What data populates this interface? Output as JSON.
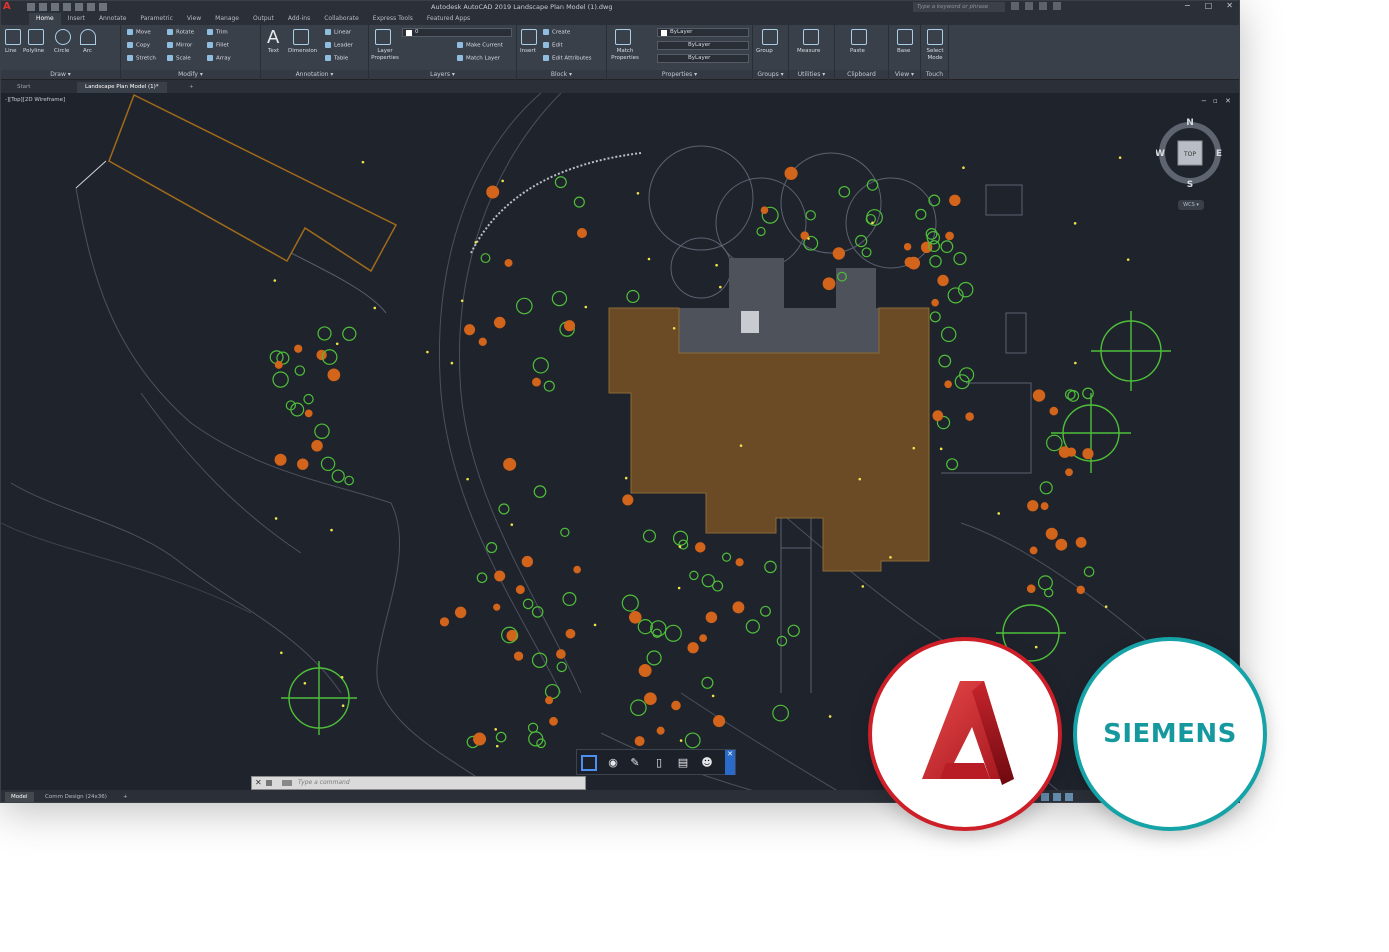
{
  "window": {
    "app_logo": "A",
    "title": "Autodesk AutoCAD 2019   Landscape Plan Model (1).dwg",
    "search_placeholder": "Type a keyword or phrase",
    "controls": [
      "−",
      "□",
      "✕"
    ]
  },
  "ribbon_tabs": [
    "Home",
    "Insert",
    "Annotate",
    "Parametric",
    "View",
    "Manage",
    "Output",
    "Add-ins",
    "Collaborate",
    "Express Tools",
    "Featured Apps"
  ],
  "ribbon": {
    "draw": {
      "title": "Draw ▾",
      "tools": [
        "Line",
        "Polyline",
        "Circle",
        "Arc"
      ]
    },
    "modify": {
      "title": "Modify ▾",
      "tools": [
        "Move",
        "Rotate",
        "Trim",
        "Copy",
        "Mirror",
        "Fillet",
        "Stretch",
        "Scale",
        "Array"
      ]
    },
    "annotation": {
      "title": "Annotation ▾",
      "tools": [
        "Text",
        "Dimension",
        "Linear",
        "Leader",
        "Table"
      ]
    },
    "layers": {
      "title": "Layers ▾",
      "tools": [
        "Layer Properties",
        "Make Current",
        "Match Layer"
      ],
      "current_layer": "0"
    },
    "block": {
      "title": "Block ▾",
      "tools": [
        "Insert",
        "Create",
        "Edit",
        "Edit Attributes"
      ]
    },
    "properties": {
      "title": "Properties ▾",
      "tools": [
        "Match Properties"
      ],
      "dropdowns": [
        "ByLayer",
        "ByLayer",
        "ByLayer"
      ]
    },
    "groups": {
      "title": "Groups ▾",
      "tools": [
        "Group"
      ]
    },
    "utilities": {
      "title": "Utilities ▾",
      "tools": [
        "Measure"
      ]
    },
    "clipboard": {
      "title": "Clipboard",
      "tools": [
        "Paste"
      ]
    },
    "view": {
      "title": "View ▾",
      "tools": [
        "Base"
      ]
    },
    "touch": {
      "title": "Touch",
      "tools": [
        "Select Mode"
      ]
    }
  },
  "file_tabs": [
    "Start",
    "Landscape Plan Model (1)*",
    "+"
  ],
  "viewport": {
    "label": "-][Top][2D Wireframe]",
    "controls": [
      "−",
      "▫",
      "✕"
    ]
  },
  "viewcube": {
    "n": "N",
    "s": "S",
    "e": "E",
    "w": "W",
    "face": "TOP",
    "wcs": "WCS ▾"
  },
  "command_line": {
    "placeholder": "Type a command"
  },
  "layout_tabs": [
    "Model",
    "Comm Design (24x36)",
    "+"
  ],
  "logos": {
    "siemens": "SIEMENS"
  },
  "colors": {
    "canvas_bg": "#1f232c",
    "building": "#6b4a26",
    "plants_green": "#4fbf3a",
    "plants_orange": "#d2641b",
    "autocad_red": "#cc1f28",
    "siemens_teal": "#16999e"
  }
}
